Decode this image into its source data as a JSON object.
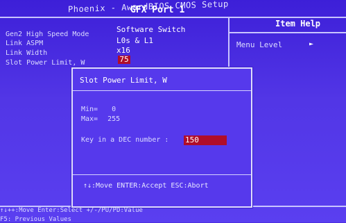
{
  "header": {
    "brand": "Phoenix - AwardBIOS CMOS Setup",
    "page_title": "GFX Port 1"
  },
  "settings": [
    {
      "label": "Gen2 High Speed Mode",
      "value": "Software Switch"
    },
    {
      "label": "Link ASPM",
      "value": "L0s & L1"
    },
    {
      "label": "Link Width",
      "value": "x16"
    },
    {
      "label": "Slot Power Limit, W",
      "value": "75"
    }
  ],
  "help": {
    "title": "Item Help",
    "menu_level": "Menu Level",
    "arrow": "►"
  },
  "dialog": {
    "title": "Slot Power Limit, W",
    "min_label": "Min=",
    "min_value": "0",
    "max_label": "Max=",
    "max_value": "255",
    "prompt": "Key in a DEC number :",
    "input_value": "150",
    "keys": "↑↓:Move ENTER:Accept ESC:Abort"
  },
  "footer": {
    "line1": "↑↓++:Move  Enter:Select  +/-/PU/PD:Value",
    "line2": "F5: Previous Values"
  },
  "colors": {
    "background": "#4d2fe0",
    "highlight": "#b00d2a",
    "frame": "#c9c4ff"
  }
}
